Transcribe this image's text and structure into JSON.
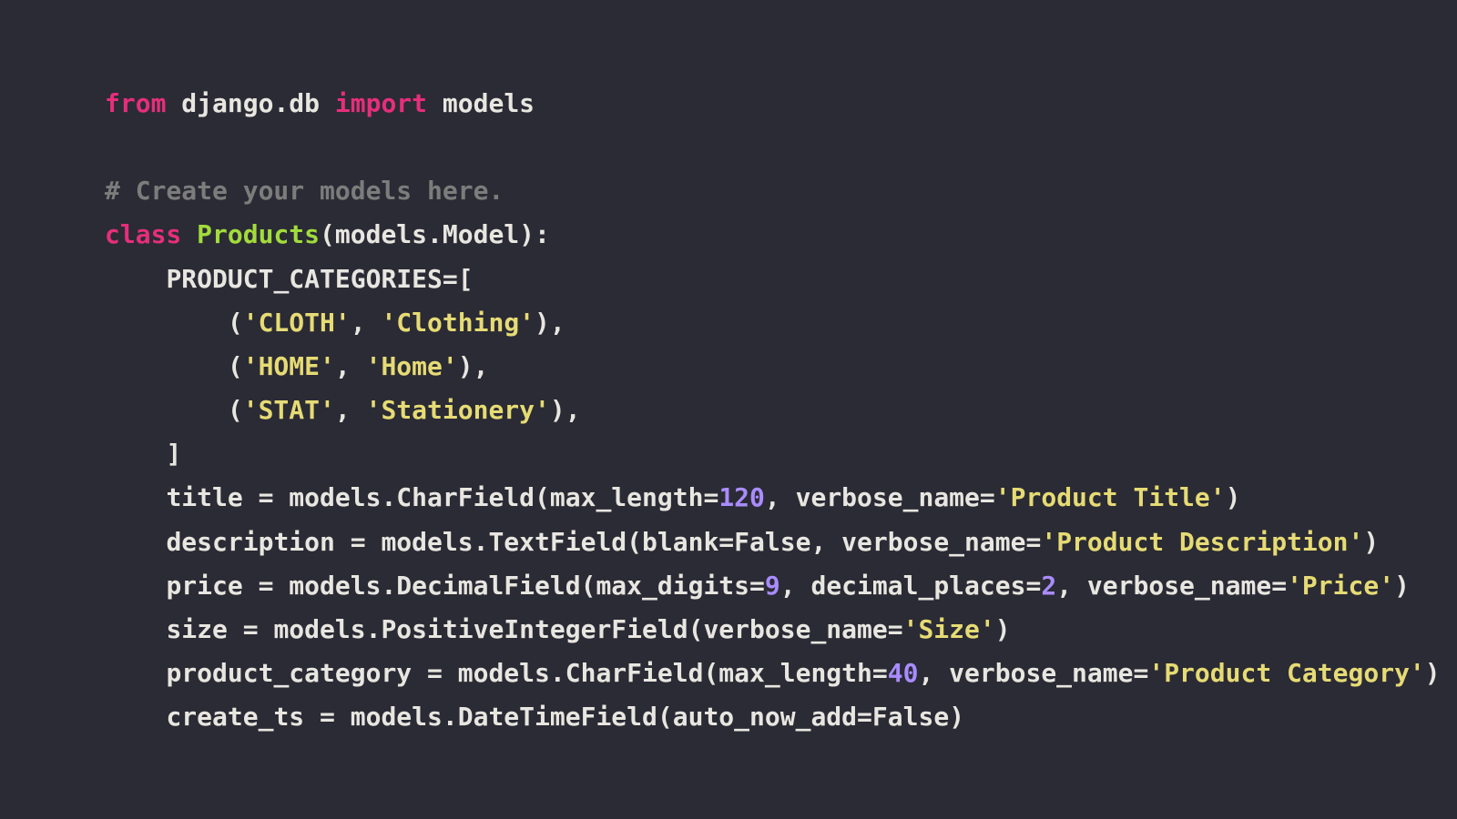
{
  "code": {
    "line1": {
      "kw1": "from",
      "mod": " django.db ",
      "kw2": "import",
      "names": " models"
    },
    "blank1": " ",
    "line2": {
      "comment": "# Create your models here."
    },
    "line3": {
      "kw": "class",
      "sp": " ",
      "cls": "Products",
      "rest": "(models.Model):"
    },
    "line4": {
      "indent": "    ",
      "txt": "PRODUCT_CATEGORIES=["
    },
    "line5": {
      "indent": "        (",
      "s1": "'CLOTH'",
      "mid": ", ",
      "s2": "'Clothing'",
      "end": "),"
    },
    "line6": {
      "indent": "        (",
      "s1": "'HOME'",
      "mid": ", ",
      "s2": "'Home'",
      "end": "),"
    },
    "line7": {
      "indent": "        (",
      "s1": "'STAT'",
      "mid": ", ",
      "s2": "'Stationery'",
      "end": "),"
    },
    "line8": {
      "indent": "    ",
      "txt": "]"
    },
    "line9": {
      "indent": "    ",
      "pre": "title = models.CharField(max_length=",
      "num": "120",
      "mid": ", verbose_name=",
      "str": "'Product Title'",
      "end": ")"
    },
    "line10": {
      "indent": "    ",
      "pre": "description = models.TextField(blank=",
      "bool": "False",
      "mid": ", verbose_name=",
      "str": "'Product Description'",
      "end": ")"
    },
    "line11": {
      "indent": "    ",
      "pre": "price = models.DecimalField(max_digits=",
      "n1": "9",
      "mid1": ", decimal_places=",
      "n2": "2",
      "mid2": ", verbose_name=",
      "str": "'Price'",
      "end": ")"
    },
    "line12": {
      "indent": "    ",
      "pre": "size = models.PositiveIntegerField(verbose_name=",
      "str": "'Size'",
      "end": ")"
    },
    "line13": {
      "indent": "    ",
      "pre": "product_category = models.CharField(max_length=",
      "num": "40",
      "mid": ", verbose_name=",
      "str": "'Product Category'",
      "end": ")"
    },
    "line14": {
      "indent": "    ",
      "pre": "create_ts = models.DateTimeField(auto_now_add=",
      "bool": "False",
      "end": ")"
    }
  }
}
